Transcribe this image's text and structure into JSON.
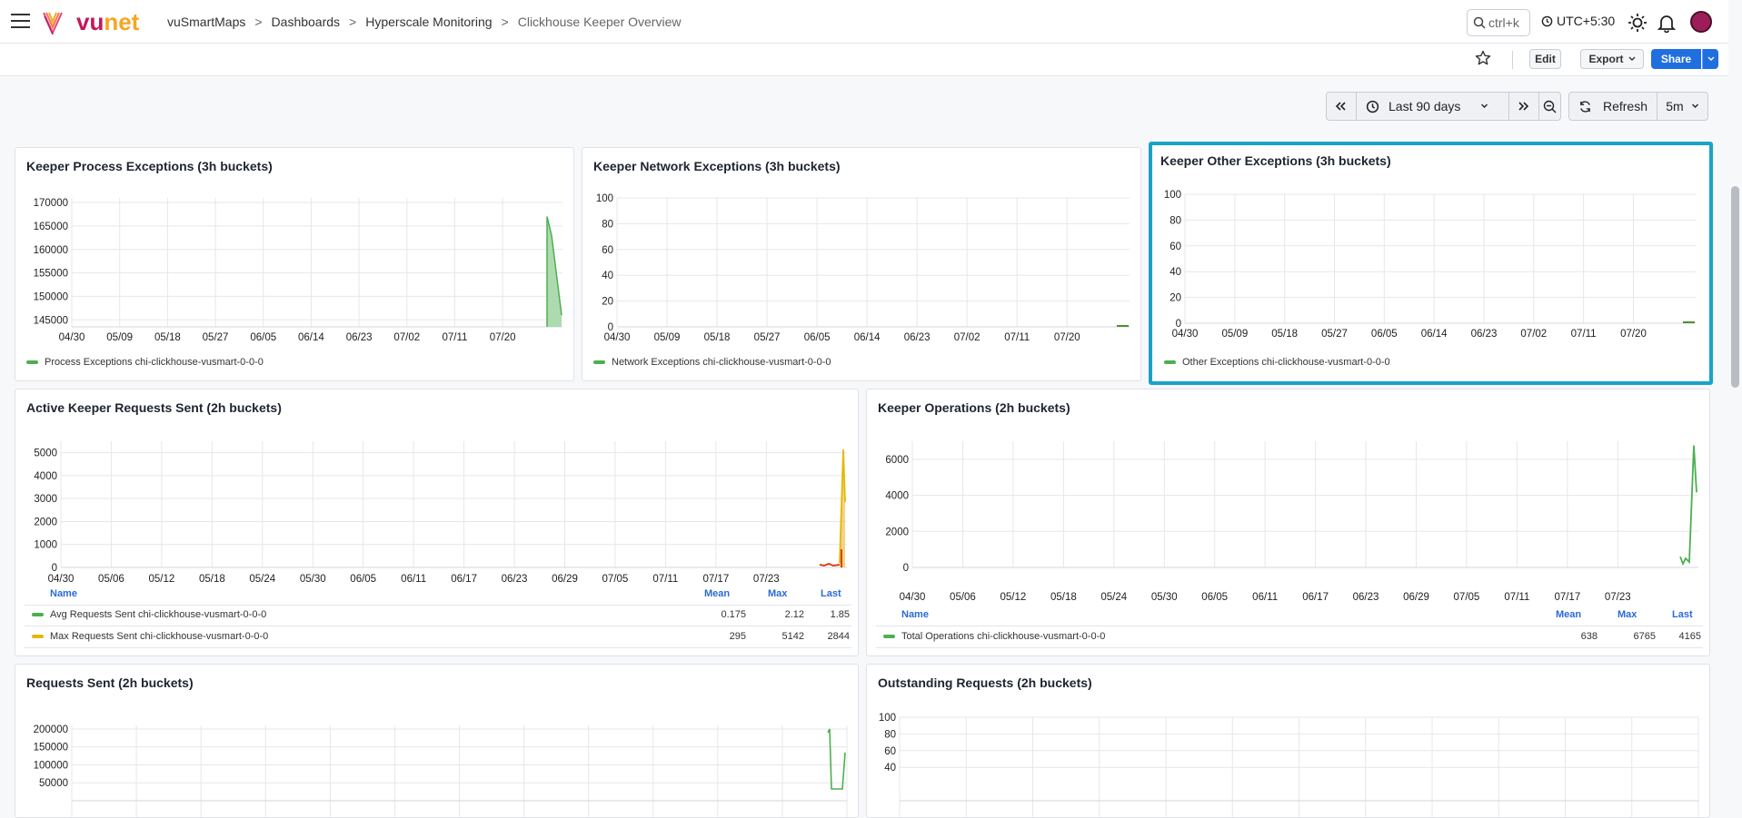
{
  "header": {
    "logo_prefix": "vu",
    "logo_suffix": "net",
    "breadcrumb": [
      "vuSmartMaps",
      "Dashboards",
      "Hyperscale Monitoring",
      "Clickhouse Keeper Overview"
    ],
    "search_placeholder": "ctrl+k",
    "timezone": "UTC+5:30"
  },
  "toolbar": {
    "edit_label": "Edit",
    "export_label": "Export",
    "share_label": "Share"
  },
  "timepicker": {
    "range_label": "Last 90 days",
    "refresh_label": "Refresh",
    "interval_label": "5m"
  },
  "colors": {
    "accent": "#1f6fe0",
    "selected_border": "#1aa3c8",
    "series_green": "#4caf50",
    "series_yellow": "#e6b800",
    "series_red": "#d84315"
  },
  "panels": {
    "process": {
      "title": "Keeper Process Exceptions (3h buckets)",
      "legend": "Process Exceptions chi-clickhouse-vusmart-0-0-0"
    },
    "network": {
      "title": "Keeper Network Exceptions (3h buckets)",
      "legend": "Network Exceptions chi-clickhouse-vusmart-0-0-0"
    },
    "other": {
      "title": "Keeper Other Exceptions (3h buckets)",
      "legend": "Other Exceptions chi-clickhouse-vusmart-0-0-0"
    },
    "active": {
      "title": "Active Keeper Requests Sent (2h buckets)",
      "table_headers": [
        "Name",
        "Mean",
        "Max",
        "Last"
      ],
      "rows": [
        {
          "name": "Avg Requests Sent chi-clickhouse-vusmart-0-0-0",
          "mean": "0.175",
          "max": "2.12",
          "last": "1.85"
        },
        {
          "name": "Max Requests Sent chi-clickhouse-vusmart-0-0-0",
          "mean": "295",
          "max": "5142",
          "last": "2844"
        }
      ]
    },
    "operations": {
      "title": "Keeper Operations (2h buckets)",
      "table_headers": [
        "Name",
        "Mean",
        "Max",
        "Last"
      ],
      "rows": [
        {
          "name": "Total Operations chi-clickhouse-vusmart-0-0-0",
          "mean": "638",
          "max": "6765",
          "last": "4165"
        }
      ]
    },
    "requests_sent": {
      "title": "Requests Sent (2h buckets)"
    },
    "outstanding": {
      "title": "Outstanding Requests (2h buckets)"
    }
  },
  "chart_data": [
    {
      "type": "area",
      "title": "Keeper Process Exceptions (3h buckets)",
      "x_ticks": [
        "04/30",
        "05/09",
        "05/18",
        "05/27",
        "06/05",
        "06/14",
        "06/23",
        "07/02",
        "07/11",
        "07/20"
      ],
      "y_ticks": [
        "170000",
        "165000",
        "160000",
        "155000",
        "150000",
        "145000"
      ],
      "ylim": [
        143500,
        171000
      ],
      "series": [
        {
          "name": "Process Exceptions chi-clickhouse-vusmart-0-0-0",
          "color": "#4caf50",
          "x": [
            "07/28",
            "07/29",
            "07/29",
            "07/30"
          ],
          "values": [
            167000,
            163000,
            163000,
            146000
          ]
        }
      ]
    },
    {
      "type": "line",
      "title": "Keeper Network Exceptions (3h buckets)",
      "x_ticks": [
        "04/30",
        "05/09",
        "05/18",
        "05/27",
        "06/05",
        "06/14",
        "06/23",
        "07/02",
        "07/11",
        "07/20"
      ],
      "y_ticks": [
        "100",
        "80",
        "60",
        "40",
        "20",
        "0"
      ],
      "ylim": [
        0,
        100
      ],
      "series": [
        {
          "name": "Network Exceptions chi-clickhouse-vusmart-0-0-0",
          "color": "#4caf50",
          "x": [
            "07/28",
            "07/30"
          ],
          "values": [
            0,
            0
          ]
        }
      ]
    },
    {
      "type": "line",
      "title": "Keeper Other Exceptions (3h buckets)",
      "x_ticks": [
        "04/30",
        "05/09",
        "05/18",
        "05/27",
        "06/05",
        "06/14",
        "06/23",
        "07/02",
        "07/11",
        "07/20"
      ],
      "y_ticks": [
        "100",
        "80",
        "60",
        "40",
        "20",
        "0"
      ],
      "ylim": [
        0,
        100
      ],
      "series": [
        {
          "name": "Other Exceptions chi-clickhouse-vusmart-0-0-0",
          "color": "#4caf50",
          "x": [
            "07/28",
            "07/30"
          ],
          "values": [
            0,
            0
          ]
        }
      ]
    },
    {
      "type": "line",
      "title": "Active Keeper Requests Sent (2h buckets)",
      "x_ticks": [
        "04/30",
        "05/06",
        "05/12",
        "05/18",
        "05/24",
        "05/30",
        "06/05",
        "06/11",
        "06/17",
        "06/23",
        "06/29",
        "07/05",
        "07/11",
        "07/17",
        "07/23"
      ],
      "y_ticks": [
        "5000",
        "4000",
        "3000",
        "2000",
        "1000",
        "0"
      ],
      "ylim": [
        0,
        5500
      ],
      "series": [
        {
          "name": "Avg Requests Sent chi-clickhouse-vusmart-0-0-0",
          "color": "#4caf50",
          "values": [
            2,
            1,
            2,
            1.85
          ]
        },
        {
          "name": "Max Requests Sent chi-clickhouse-vusmart-0-0-0",
          "color": "#e6b800",
          "values": [
            100,
            200,
            5142,
            2844
          ]
        }
      ]
    },
    {
      "type": "line",
      "title": "Keeper Operations (2h buckets)",
      "x_ticks": [
        "04/30",
        "05/06",
        "05/12",
        "05/18",
        "05/24",
        "05/30",
        "06/05",
        "06/11",
        "06/17",
        "06/23",
        "06/29",
        "07/05",
        "07/11",
        "07/17",
        "07/23"
      ],
      "y_ticks": [
        "6000",
        "4000",
        "2000",
        "0"
      ],
      "ylim": [
        0,
        7000
      ],
      "series": [
        {
          "name": "Total Operations chi-clickhouse-vusmart-0-0-0",
          "color": "#4caf50",
          "values": [
            600,
            200,
            500,
            300,
            6765,
            4165
          ]
        }
      ]
    },
    {
      "type": "line",
      "title": "Requests Sent (2h buckets)",
      "y_ticks": [
        "200000",
        "150000",
        "100000",
        "50000"
      ],
      "ylim": [
        0,
        210000
      ]
    },
    {
      "type": "line",
      "title": "Outstanding Requests (2h buckets)",
      "y_ticks": [
        "100",
        "80",
        "60",
        "40"
      ],
      "ylim": [
        0,
        100
      ]
    }
  ]
}
